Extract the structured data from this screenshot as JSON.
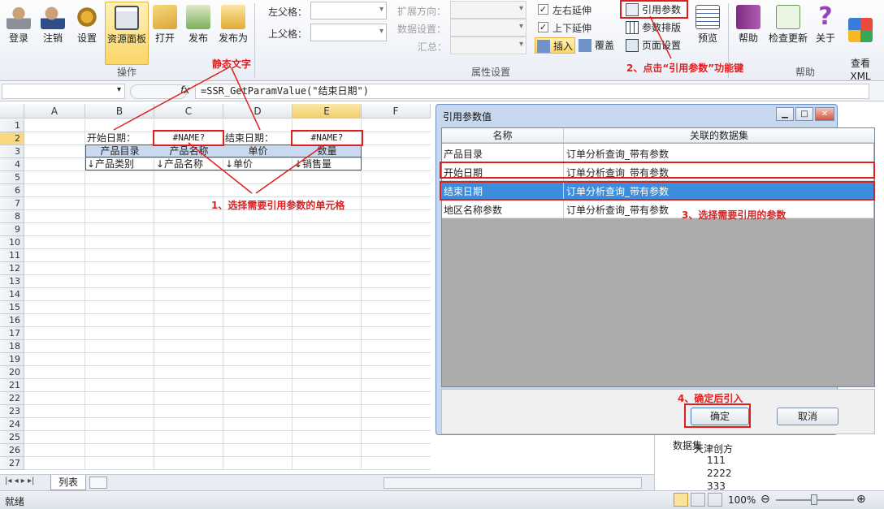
{
  "ribbon": {
    "buttons": [
      {
        "label": "登录",
        "icon": "login-icon"
      },
      {
        "label": "注销",
        "icon": "logout-icon"
      },
      {
        "label": "设置",
        "icon": "settings-icon"
      },
      {
        "label": "资源面板",
        "icon": "resource-panel-icon"
      },
      {
        "label": "打开",
        "icon": "open-folder-icon"
      },
      {
        "label": "发布",
        "icon": "publish-icon"
      },
      {
        "label": "发布为",
        "icon": "publish-as-icon"
      }
    ],
    "group_operations": "操作",
    "left_parent_label": "左父格：",
    "top_parent_label": "上父格：",
    "expand_dir_label": "扩展方向：",
    "data_setting_label": "数据设置：",
    "summary_label": "汇总：",
    "lr_extend": "左右延伸",
    "ud_extend": "上下延伸",
    "insert": "插入",
    "overwrite": "覆盖",
    "group_properties": "属性设置",
    "ref_param": "引用参数",
    "param_layout": "参数排版",
    "page_setup": "页面设置",
    "preview": "预览",
    "help": "帮助",
    "check_update": "检查更新",
    "about": "关于",
    "view_xml": "查看\nXML",
    "group_help": "帮助"
  },
  "formula": {
    "value": "=SSR_GetParamValue(\"结束日期\")"
  },
  "sheet": {
    "columns": [
      "A",
      "B",
      "C",
      "D",
      "E",
      "F"
    ],
    "rows": [
      "1",
      "2",
      "3",
      "4",
      "5",
      "6",
      "7",
      "8",
      "9",
      "10",
      "11",
      "12",
      "13",
      "14",
      "15",
      "16",
      "17",
      "18",
      "19",
      "20",
      "21",
      "22",
      "23",
      "24",
      "25",
      "26",
      "27"
    ],
    "b2": "开始日期：",
    "c2": "#NAME?",
    "d2": "结束日期：",
    "e2": "#NAME?",
    "header_row": [
      "产品目录",
      "产品名称",
      "单价",
      "数量"
    ],
    "data_row": [
      "↓产品类别",
      "↓产品名称",
      "↓单价",
      "↓销售量"
    ],
    "tab": "列表"
  },
  "annotations": {
    "static_text": "静态文字",
    "step1": "1、选择需要引用参数的单元格",
    "step2": "2、点击“引用参数”功能键",
    "step3": "3、选择需要引用的参数",
    "step4": "4、确定后引入"
  },
  "dialog": {
    "title": "引用参数值",
    "col_name": "名称",
    "col_dataset": "关联的数据集",
    "rows": [
      {
        "name": "产品目录",
        "dataset": "订单分析查询_带有参数"
      },
      {
        "name": "开始日期",
        "dataset": "订单分析查询_带有参数"
      },
      {
        "name": "结束日期",
        "dataset": "订单分析查询_带有参数"
      },
      {
        "name": "地区名称参数",
        "dataset": "订单分析查询_带有参数"
      }
    ],
    "ok": "确定",
    "cancel": "取消"
  },
  "tree": {
    "items": [
      "数据集",
      "天津创方",
      "111",
      "2222",
      "333"
    ]
  },
  "status": {
    "ready": "就绪",
    "zoom": "100%"
  }
}
